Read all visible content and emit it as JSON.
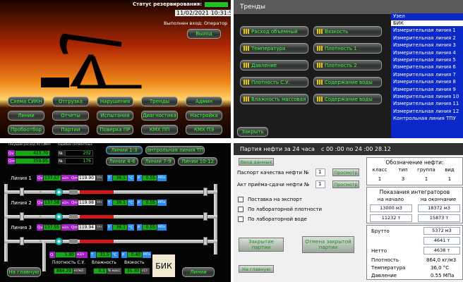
{
  "p1": {
    "status_label": "Статус резервирования:",
    "datetime": "11/02/2021 10:31:54",
    "login_text": "Выполнен вход: Оператор",
    "logout": "Выход",
    "buttons": [
      [
        "Схема СИКН",
        "Отгрузка",
        "Нарушения",
        "Тренды",
        "Админ"
      ],
      [
        "Линии",
        "Отчеты",
        "Испытания",
        "Диагностика",
        "Настройка"
      ],
      [
        "Пробоотбор",
        "Партии",
        "Поверка ПР",
        "КМХ ПП",
        "КМХ ПЭ"
      ]
    ]
  },
  "p2": {
    "title": "Тренды",
    "left_buttons": [
      "Расход объемный",
      "Температура",
      "Давление",
      "Плотность С.У.",
      "Влажность массовая"
    ],
    "right_buttons": [
      "Вязкость",
      "Плотность 1",
      "Плотность 2",
      "Содержание воды",
      "Содержание воды"
    ],
    "list_header": "Узел",
    "list_items": [
      "БИК",
      "Измерительная линия 1",
      "Измерительная линия 2",
      "Измерительная линия 3",
      "Измерительная линия 4",
      "Измерительная линия 5",
      "Измерительная линия 6",
      "Измерительная линия 7",
      "Измерительная линия 8",
      "Измерительная линия 9",
      "Измерительная линия 10",
      "Измерительная линия 11",
      "Измерительная линия 12",
      "Контрольная линия ТПУ"
    ],
    "selected_index": 0,
    "close": "Закрыть"
  },
  "p3": {
    "small_header1": "Текущий расход по СИКН",
    "small_header2": "Ошибки сегментных",
    "qv_label": "Qv",
    "qv_value": "413.70",
    "qm_label": "Qm",
    "qm_value": "359.95",
    "g1_label": "№",
    "g1_value": "202",
    "g2_label": "№",
    "g2_value": "176",
    "tabs": [
      "Линии 1-3",
      "Контрольная линия ТПУ",
      "Линии 4-6",
      "Линии 7-9",
      "Линии 10-12"
    ],
    "lines": [
      {
        "label": "Линия 1",
        "qv": "137.57",
        "qm": "119.90",
        "t": "36.1",
        "p": "0.55"
      },
      {
        "label": "Линия 2",
        "qv": "137.58",
        "qm": "119.98",
        "t": "36.1",
        "p": "0.55"
      },
      {
        "label": "Линия 3",
        "qv": "137.55",
        "qm": "119.94",
        "t": "36.1",
        "p": "0.55"
      }
    ],
    "qv_tag": "Qv",
    "qm_tag": "Qm",
    "t_tag": "T",
    "p_tag": "P",
    "qv_unit": "м3/ч",
    "qm_unit": "т/ч",
    "t_unit": "°C",
    "p_unit": "МПа",
    "bik": {
      "q": "5.80",
      "q_unit": "м3/ч",
      "t": "31.5",
      "t_unit": "°C",
      "p": "0.40",
      "p_unit": "МПа",
      "labels": [
        "Плотность С.У.",
        "Влажность",
        "Вязкость"
      ],
      "values": [
        "884.29",
        "0.1",
        "35.30"
      ],
      "units": [
        "кг/м3",
        "% масс.",
        "сСт"
      ],
      "name": "БИК"
    },
    "home": "На главную",
    "lines_btn": "Линии"
  },
  "p4": {
    "title": "Партия нефти за 24 часа",
    "period": "с 00 :00 по 24 :00  28.12",
    "enter_data": "Ввод данных",
    "quality_label": "Паспорт качества нефти №",
    "acceptance_label": "Акт приёма-сдачи нефти №",
    "field_value": "1",
    "view": "Просмотр",
    "checks": [
      "Поставка на экспорт",
      "По лабораторной плотности",
      "По лабораторной воде"
    ],
    "close_batch": "Закрытие партии",
    "cancel_batch": "Отмена закрытой партии",
    "home": "На главную",
    "oil_title": "Обозначение нефти:",
    "oil_headers": [
      "класс",
      "тип",
      "группа",
      "вид"
    ],
    "oil_values": [
      "1",
      "3",
      "1",
      "1"
    ],
    "integ_title": "Показания интеграторов",
    "integ_headers": [
      "на начало",
      "на окончание"
    ],
    "integ_rows": [
      [
        "13000 м3",
        "18372 м3"
      ],
      [
        "11232 т",
        "15873 т"
      ]
    ],
    "brutto_label": "Брутто",
    "brutto_values": [
      "5372 м3",
      "4641 т"
    ],
    "netto_label": "Нетто",
    "netto_value": "4638 т",
    "props": [
      [
        "Плотность",
        "864,0 кг/м3"
      ],
      [
        "Температура",
        "36,0 °C"
      ],
      [
        "Давление",
        "0.55 МПа"
      ]
    ]
  }
}
